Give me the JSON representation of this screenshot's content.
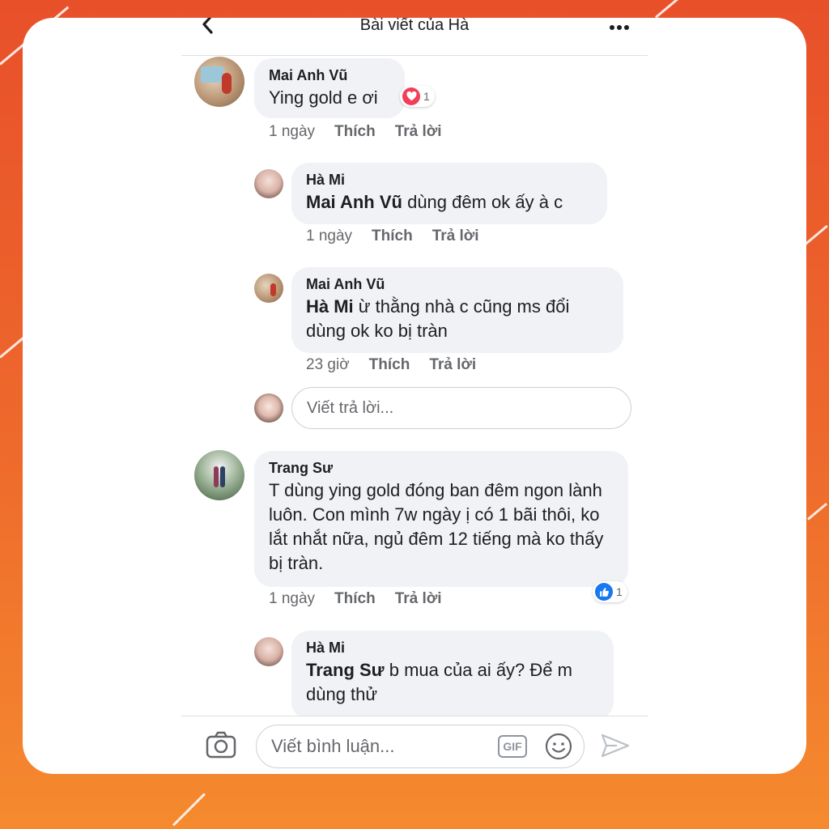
{
  "header": {
    "title": "Bài viết của Hà"
  },
  "comments": [
    {
      "author": "Mai Anh Vũ",
      "text": "Ying gold e ơi",
      "time": "1 ngày",
      "like": "Thích",
      "reply": "Trả lời",
      "reaction_count": "1",
      "reaction_icon": "heart-icon",
      "replies": [
        {
          "author": "Hà Mi",
          "mention": "Mai Anh Vũ",
          "text": " dùng đêm ok ấy à c",
          "time": "1 ngày",
          "like": "Thích",
          "reply": "Trả lời"
        },
        {
          "author": "Mai Anh Vũ",
          "mention": "Hà Mi",
          "text": "  ừ thằng nhà c cũng ms đổi dùng ok ko bị tràn",
          "time": "23 giờ",
          "like": "Thích",
          "reply": "Trả lời"
        }
      ],
      "reply_placeholder": "Viết trả lời..."
    },
    {
      "author": "Trang Sư",
      "text": "T dùng ying gold đóng ban đêm ngon lành luôn. Con mình 7w ngày ị có 1 bãi thôi, ko lắt nhắt nữa, ngủ đêm 12 tiếng mà ko thấy bị tràn.",
      "time": "1 ngày",
      "like": "Thích",
      "reply": "Trả lời",
      "reaction_count": "1",
      "reaction_icon": "thumbs-up-icon",
      "replies": [
        {
          "author": "Hà Mi",
          "mention": "Trang Sư",
          "text": " b mua của ai ấy? Để m dùng thử"
        }
      ]
    }
  ],
  "composer": {
    "placeholder": "Viết bình luận...",
    "gif_label": "GIF"
  },
  "colors": {
    "accent": "#1877f2",
    "reaction_heart": "#f33e58",
    "background_orange": "#ee6a2c"
  }
}
